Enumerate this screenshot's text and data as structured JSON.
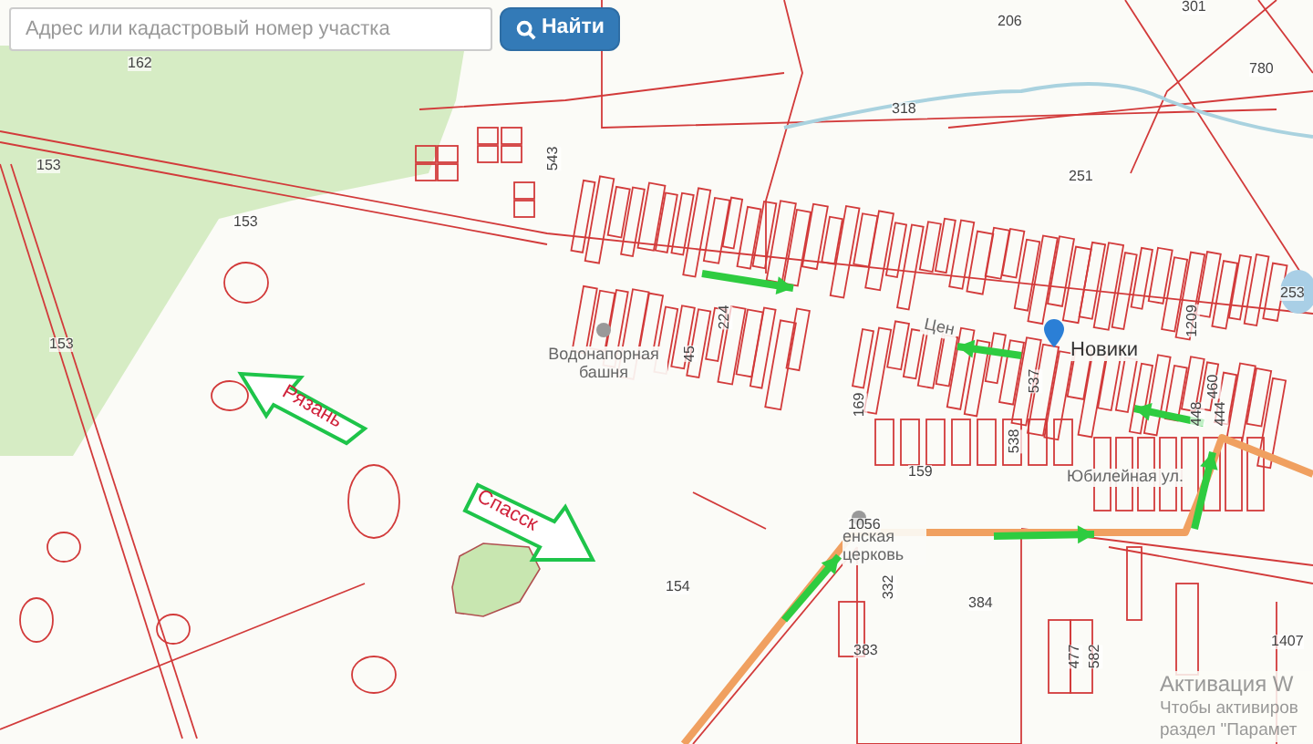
{
  "search": {
    "placeholder": "Адрес или кадастровый номер участка",
    "button": "Найти"
  },
  "map": {
    "parcel_numbers": [
      "162",
      "153",
      "153",
      "153",
      "543",
      "318",
      "206",
      "301",
      "780",
      "251",
      "253",
      "224",
      "45",
      "169",
      "159",
      "537",
      "538",
      "1209",
      "460",
      "448",
      "444",
      "1056",
      "332",
      "383",
      "384",
      "477",
      "582",
      "154",
      "1407"
    ],
    "places": [
      "Водонапорная башня",
      "Новики",
      "Цен",
      "Юбилейная ул.",
      "енская церковь"
    ],
    "direction_arrows": [
      "Рязань",
      "Спасск"
    ]
  },
  "system_notice": [
    "Активация W",
    "Чтобы активиров",
    "раздел \"Парамет"
  ]
}
